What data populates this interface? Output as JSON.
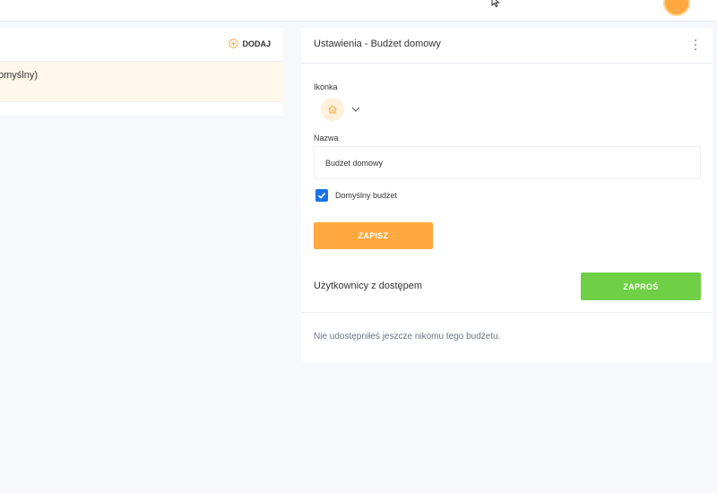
{
  "left": {
    "add_label": "DODAJ",
    "budget_item_label": "omyślny)"
  },
  "settings": {
    "title": "Ustawienia - Budżet domowy",
    "icon_label": "Ikonka",
    "icon_name": "home-icon",
    "name_label": "Nazwa",
    "name_value": "Budżet domowy",
    "default_checkbox_label": "Domyślny budżet",
    "default_checked": true,
    "save_label": "ZAPISZ"
  },
  "users": {
    "title": "Użytkownicy z dostępem",
    "invite_label": "ZAPROŚ",
    "empty_message": "Nie udostępniłeś jeszcze nikomu tego budżetu."
  },
  "colors": {
    "accent": "#ffa940",
    "accent_light": "#fff7ea",
    "invite": "#6fcf45",
    "checkbox": "#1a73e8"
  }
}
